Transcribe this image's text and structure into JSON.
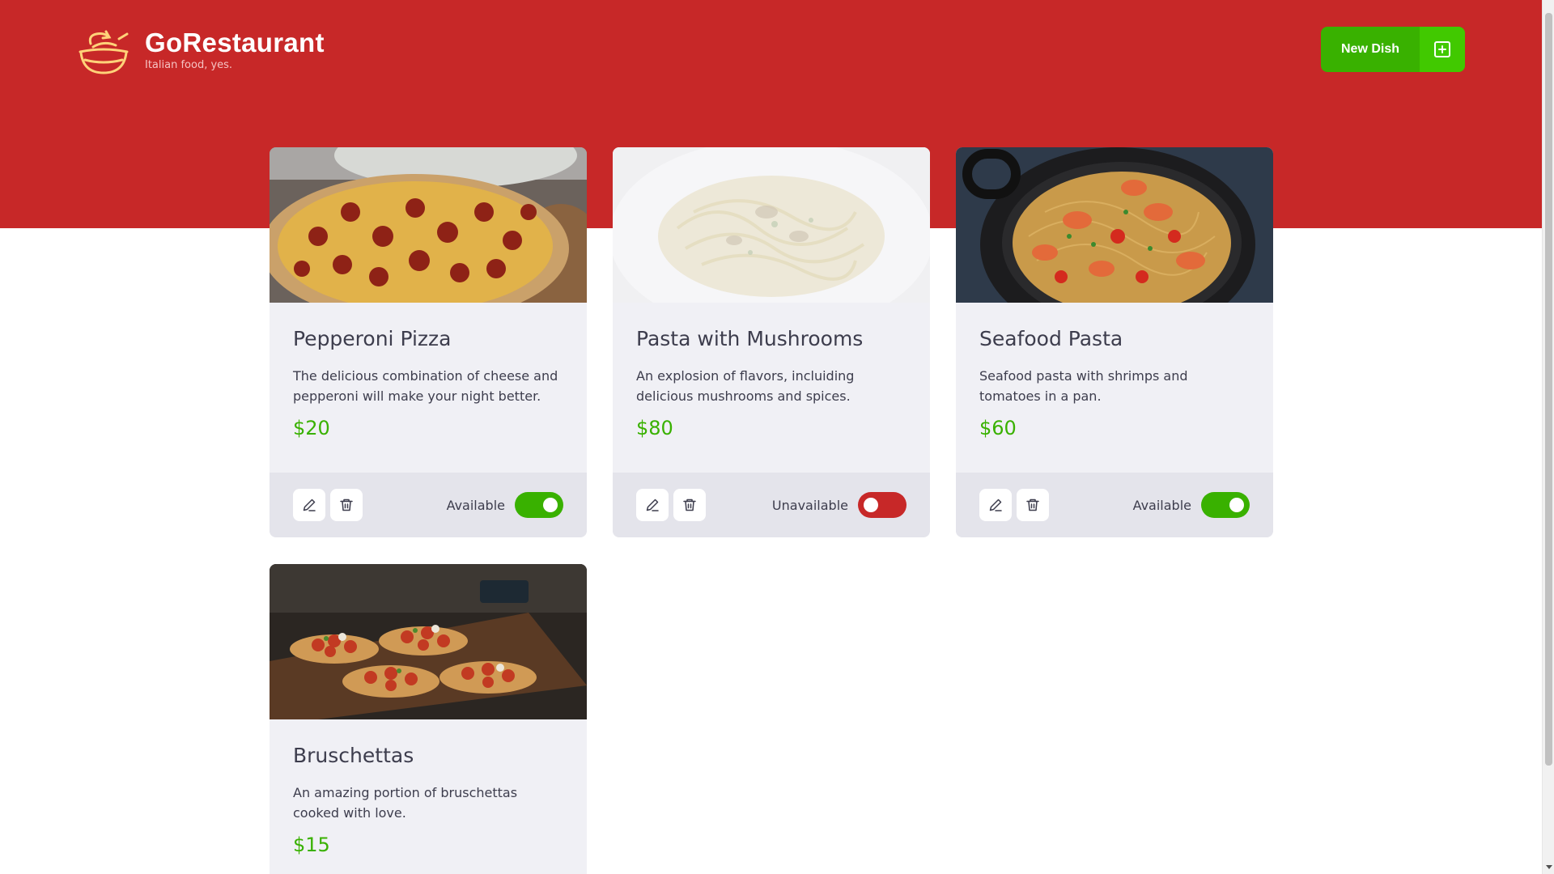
{
  "brand": {
    "title": "GoRestaurant",
    "subtitle": "Italian food, yes.",
    "logo_icon": "bowl-icon"
  },
  "header": {
    "new_dish_label": "New Dish",
    "new_dish_icon": "plus-square-icon"
  },
  "colors": {
    "primary_red": "#c72828",
    "green": "#39b100",
    "card_bg": "#f0f0f5",
    "footer_bg": "#e4e4eb"
  },
  "dishes": [
    {
      "name": "Pepperoni Pizza",
      "description": "The delicious combination of cheese and pepperoni will make your night better.",
      "price": "$20",
      "status": "Available",
      "available": true
    },
    {
      "name": "Pasta with Mushrooms",
      "description": "An explosion of flavors, incluiding delicious mushrooms and spices.",
      "price": "$80",
      "status": "Unavailable",
      "available": false
    },
    {
      "name": "Seafood Pasta",
      "description": "Seafood pasta with shrimps and tomatoes in a pan.",
      "price": "$60",
      "status": "Available",
      "available": true
    },
    {
      "name": "Bruschettas",
      "description": "An amazing portion of bruschettas cooked with love.",
      "price": "$15"
    }
  ]
}
